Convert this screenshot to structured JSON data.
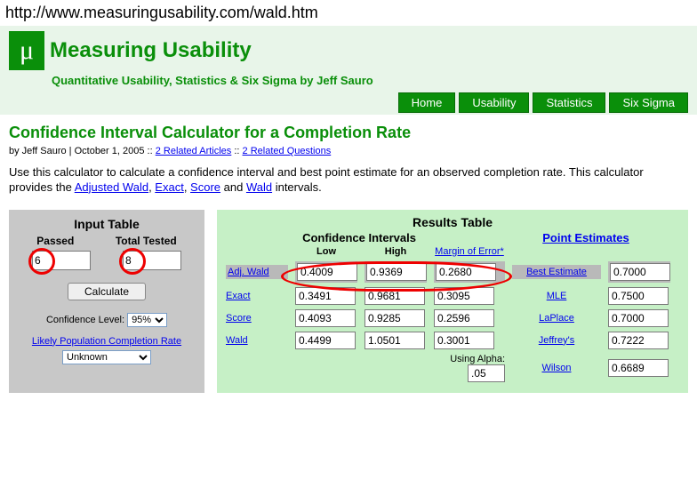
{
  "url": "http://www.measuringusability.com/wald.htm",
  "brand": "Measuring Usability",
  "tagline": "Quantitative Usability, Statistics & Six Sigma by Jeff Sauro",
  "nav": [
    "Home",
    "Usability",
    "Statistics",
    "Six Sigma"
  ],
  "page_title": "Confidence Interval Calculator for a Completion Rate",
  "byline_prefix": "by Jeff Sauro | October 1, 2005 :: ",
  "byline_link1": "2 Related Articles",
  "byline_sep": ":: ",
  "byline_link2": "2 Related Questions",
  "intro_1": "Use this calculator to calculate a confidence interval and best point estimate for an observed completion rate. This calculator provides the ",
  "intro_links": {
    "aw": "Adjusted Wald",
    "ex": "Exact",
    "sc": "Score",
    "wa": "Wald"
  },
  "intro_tail": " intervals.",
  "input": {
    "title": "Input Table",
    "passed_label": "Passed",
    "total_label": "Total Tested",
    "passed": "6",
    "total": "8",
    "calc": "Calculate",
    "cl_label": "Confidence Level:",
    "cl_value": "95%",
    "lpcr": "Likely Population Completion Rate",
    "unknown": "Unknown"
  },
  "results": {
    "title": "Results Table",
    "ci_header": "Confidence Intervals",
    "pe_header": "Point Estimates",
    "cols": {
      "low": "Low",
      "high": "High",
      "moe": "Margin of Error"
    },
    "rows": [
      {
        "name": "Adj. Wald",
        "low": "0.4009",
        "high": "0.9369",
        "moe": "0.2680",
        "pe_name": "Best Estimate",
        "pe": "0.7000"
      },
      {
        "name": "Exact",
        "low": "0.3491",
        "high": "0.9681",
        "moe": "0.3095",
        "pe_name": "MLE",
        "pe": "0.7500"
      },
      {
        "name": "Score",
        "low": "0.4093",
        "high": "0.9285",
        "moe": "0.2596",
        "pe_name": "LaPlace",
        "pe": "0.7000"
      },
      {
        "name": "Wald",
        "low": "0.4499",
        "high": "1.0501",
        "moe": "0.3001",
        "pe_name": "Jeffrey's",
        "pe": "0.7222"
      },
      {
        "name": "",
        "low": "",
        "high": "",
        "moe": "",
        "pe_name": "Wilson",
        "pe": "0.6689"
      }
    ],
    "alpha_label": "Using Alpha:",
    "alpha": ".05"
  }
}
